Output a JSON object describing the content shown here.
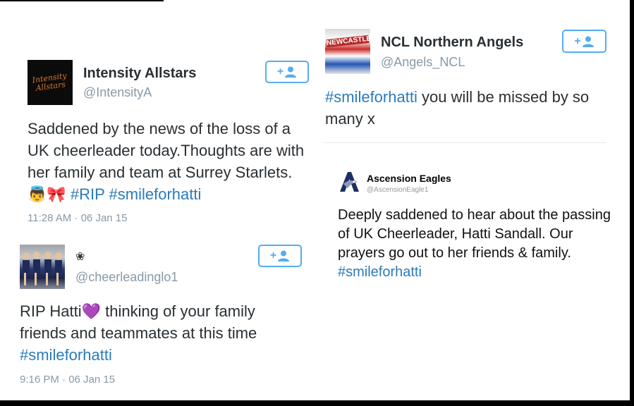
{
  "tweets": [
    {
      "name": "Intensity Allstars",
      "handle": "@IntensityA",
      "avatar_text": "Intensity Allstars",
      "text_plain": "Saddened by the news of the loss of a UK cheerleader today.Thoughts are with her family and team at Surrey Starlets. 👼🎀 ",
      "tag1": "#RIP",
      "tag2": "#smileforhatti",
      "time": "11:28 AM · 06 Jan 15"
    },
    {
      "name": "❀",
      "handle": "@cheerleadinglo1",
      "text_plain": "RIP Hatti💜 thinking of your family friends and teammates at this time ",
      "tag1": "#smileforhatti",
      "time": "9:16 PM · 06 Jan 15"
    },
    {
      "name": "NCL Northern Angels",
      "handle": "@Angels_NCL",
      "avatar_text": "NEWCASTLE",
      "tag1": "#smileforhatti",
      "text_plain": " you will be missed by so many x"
    },
    {
      "name": "Ascension Eagles",
      "handle": "@AscensionEagle1",
      "text_plain": "Deeply saddened to hear about the passing of UK Cheerleader, Hatti Sandall. Our prayers go out to her friends & family. ",
      "tag1": "#smileforhatti"
    }
  ],
  "colors": {
    "link": "#2b7bb9",
    "follow_border": "#55acee",
    "name": "#292f33",
    "muted": "#8899a6"
  },
  "icons": {
    "follow": "add-user-icon"
  }
}
